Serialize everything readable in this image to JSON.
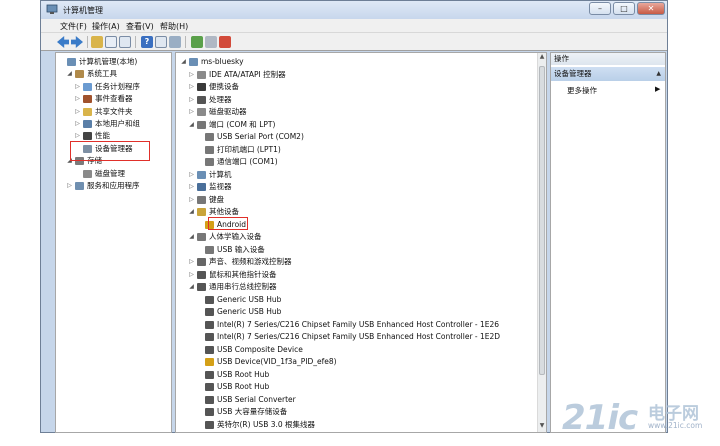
{
  "window": {
    "title": "计算机管理",
    "controls": [
      "–",
      "□",
      "✕"
    ]
  },
  "menu": [
    "文件(F)",
    "操作(A)",
    "查看(V)",
    "帮助(H)"
  ],
  "left_tree": [
    {
      "label": "计算机管理(本地)",
      "indent": 0,
      "twisty": "",
      "icon": "computer-management-icon",
      "color": "#6a8fb5"
    },
    {
      "label": "系统工具",
      "indent": 1,
      "twisty": "◢",
      "icon": "tools-icon",
      "color": "#b08a4a"
    },
    {
      "label": "任务计划程序",
      "indent": 2,
      "twisty": "▷",
      "icon": "clock-icon",
      "color": "#6b9bd1"
    },
    {
      "label": "事件查看器",
      "indent": 2,
      "twisty": "▷",
      "icon": "event-viewer-icon",
      "color": "#a0522d"
    },
    {
      "label": "共享文件夹",
      "indent": 2,
      "twisty": "▷",
      "icon": "folder-icon",
      "color": "#d9b44a"
    },
    {
      "label": "本地用户和组",
      "indent": 2,
      "twisty": "▷",
      "icon": "users-icon",
      "color": "#5a7fa8"
    },
    {
      "label": "性能",
      "indent": 2,
      "twisty": "▷",
      "icon": "performance-icon",
      "color": "#444444"
    },
    {
      "label": "设备管理器",
      "indent": 2,
      "twisty": "",
      "icon": "device-manager-icon",
      "color": "#7d8fa3"
    },
    {
      "label": "存储",
      "indent": 1,
      "twisty": "◢",
      "icon": "storage-icon",
      "color": "#7b7b7b"
    },
    {
      "label": "磁盘管理",
      "indent": 2,
      "twisty": "",
      "icon": "disk-icon",
      "color": "#8a8a8a"
    },
    {
      "label": "服务和应用程序",
      "indent": 1,
      "twisty": "▷",
      "icon": "services-icon",
      "color": "#6f8fb0"
    }
  ],
  "device_tree": [
    {
      "label": "ms-bluesky",
      "indent": 0,
      "twisty": "◢",
      "icon": "computer-icon",
      "color": "#6a8fb5"
    },
    {
      "label": "IDE ATA/ATAPI 控制器",
      "indent": 1,
      "twisty": "▷",
      "icon": "ide-controller-icon",
      "color": "#8a8a8a"
    },
    {
      "label": "便携设备",
      "indent": 1,
      "twisty": "▷",
      "icon": "portable-device-icon",
      "color": "#3a3a3a"
    },
    {
      "label": "处理器",
      "indent": 1,
      "twisty": "▷",
      "icon": "processor-icon",
      "color": "#555555"
    },
    {
      "label": "磁盘驱动器",
      "indent": 1,
      "twisty": "▷",
      "icon": "disk-drive-icon",
      "color": "#8a8a8a"
    },
    {
      "label": "端口 (COM 和 LPT)",
      "indent": 1,
      "twisty": "◢",
      "icon": "port-icon",
      "color": "#777777"
    },
    {
      "label": "USB Serial Port (COM2)",
      "indent": 2,
      "twisty": "",
      "icon": "port-icon",
      "color": "#777777"
    },
    {
      "label": "打印机端口 (LPT1)",
      "indent": 2,
      "twisty": "",
      "icon": "port-icon",
      "color": "#777777"
    },
    {
      "label": "通信端口 (COM1)",
      "indent": 2,
      "twisty": "",
      "icon": "port-icon",
      "color": "#777777"
    },
    {
      "label": "计算机",
      "indent": 1,
      "twisty": "▷",
      "icon": "computer-icon",
      "color": "#6a8fb5"
    },
    {
      "label": "监视器",
      "indent": 1,
      "twisty": "▷",
      "icon": "monitor-icon",
      "color": "#4a6f9a"
    },
    {
      "label": "键盘",
      "indent": 1,
      "twisty": "▷",
      "icon": "keyboard-icon",
      "color": "#777777"
    },
    {
      "label": "其他设备",
      "indent": 1,
      "twisty": "◢",
      "icon": "other-devices-icon",
      "color": "#c9a43a"
    },
    {
      "label": "Android",
      "indent": 2,
      "twisty": "",
      "icon": "warning-device-icon",
      "color": "#d4a017"
    },
    {
      "label": "人体学输入设备",
      "indent": 1,
      "twisty": "◢",
      "icon": "hid-icon",
      "color": "#777777"
    },
    {
      "label": "USB 输入设备",
      "indent": 2,
      "twisty": "",
      "icon": "hid-icon",
      "color": "#777777"
    },
    {
      "label": "声音、视频和游戏控制器",
      "indent": 1,
      "twisty": "▷",
      "icon": "sound-icon",
      "color": "#666666"
    },
    {
      "label": "鼠标和其他指针设备",
      "indent": 1,
      "twisty": "▷",
      "icon": "mouse-icon",
      "color": "#555555"
    },
    {
      "label": "通用串行总线控制器",
      "indent": 1,
      "twisty": "◢",
      "icon": "usb-icon",
      "color": "#555555"
    },
    {
      "label": "Generic USB Hub",
      "indent": 2,
      "twisty": "",
      "icon": "usb-icon",
      "color": "#555555"
    },
    {
      "label": "Generic USB Hub",
      "indent": 2,
      "twisty": "",
      "icon": "usb-icon",
      "color": "#555555"
    },
    {
      "label": "Intel(R) 7 Series/C216 Chipset Family USB Enhanced Host Controller - 1E26",
      "indent": 2,
      "twisty": "",
      "icon": "usb-icon",
      "color": "#555555"
    },
    {
      "label": "Intel(R) 7 Series/C216 Chipset Family USB Enhanced Host Controller - 1E2D",
      "indent": 2,
      "twisty": "",
      "icon": "usb-icon",
      "color": "#555555"
    },
    {
      "label": "USB Composite Device",
      "indent": 2,
      "twisty": "",
      "icon": "usb-icon",
      "color": "#555555"
    },
    {
      "label": "USB Device(VID_1f3a_PID_efe8)",
      "indent": 2,
      "twisty": "",
      "icon": "warning-usb-icon",
      "color": "#d4a017"
    },
    {
      "label": "USB Root Hub",
      "indent": 2,
      "twisty": "",
      "icon": "usb-icon",
      "color": "#555555"
    },
    {
      "label": "USB Root Hub",
      "indent": 2,
      "twisty": "",
      "icon": "usb-icon",
      "color": "#555555"
    },
    {
      "label": "USB Serial Converter",
      "indent": 2,
      "twisty": "",
      "icon": "usb-icon",
      "color": "#555555"
    },
    {
      "label": "USB 大容量存储设备",
      "indent": 2,
      "twisty": "",
      "icon": "usb-icon",
      "color": "#555555"
    },
    {
      "label": "英特尔(R) USB 3.0 根集线器",
      "indent": 2,
      "twisty": "",
      "icon": "usb-icon",
      "color": "#555555"
    }
  ],
  "actions": {
    "header": "操作",
    "selected": "设备管理器",
    "more": "更多操作"
  },
  "watermark": {
    "logo": "21ic",
    "cn": "电子网",
    "url": "www.21ic.com"
  }
}
